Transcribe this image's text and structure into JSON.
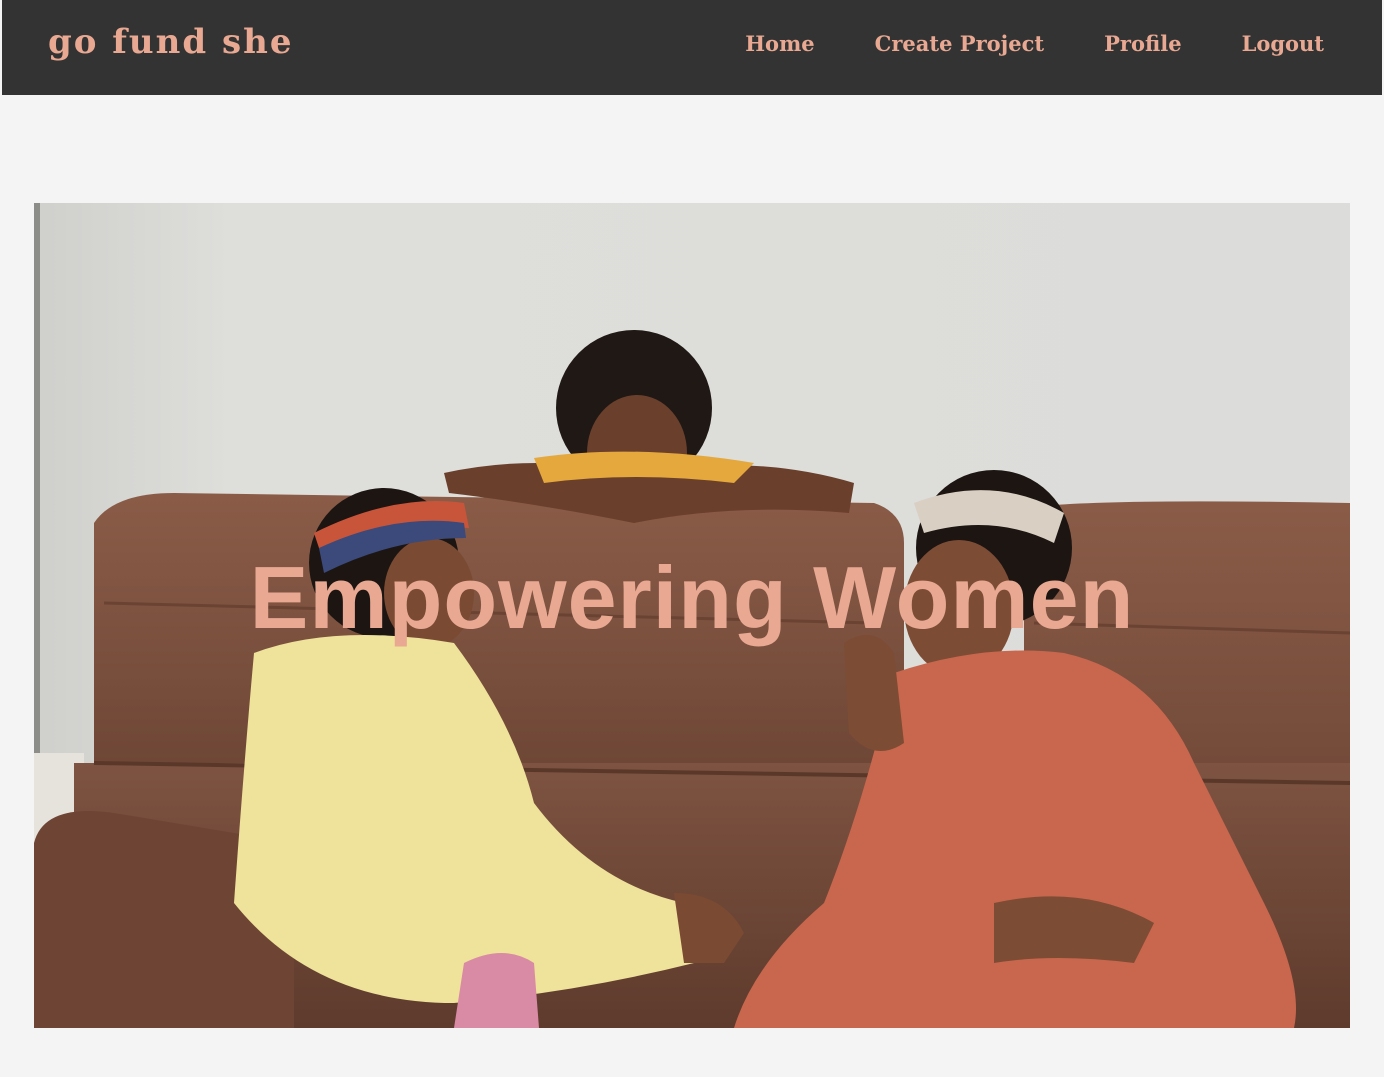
{
  "brand": {
    "name": "go fund she"
  },
  "nav": {
    "items": [
      {
        "label": "Home"
      },
      {
        "label": "Create Project"
      },
      {
        "label": "Profile"
      },
      {
        "label": "Logout"
      }
    ]
  },
  "hero": {
    "title": "Empowering Women"
  },
  "colors": {
    "navbar_bg": "#333333",
    "accent": "#e8a892",
    "page_bg": "#f4f4f4"
  }
}
